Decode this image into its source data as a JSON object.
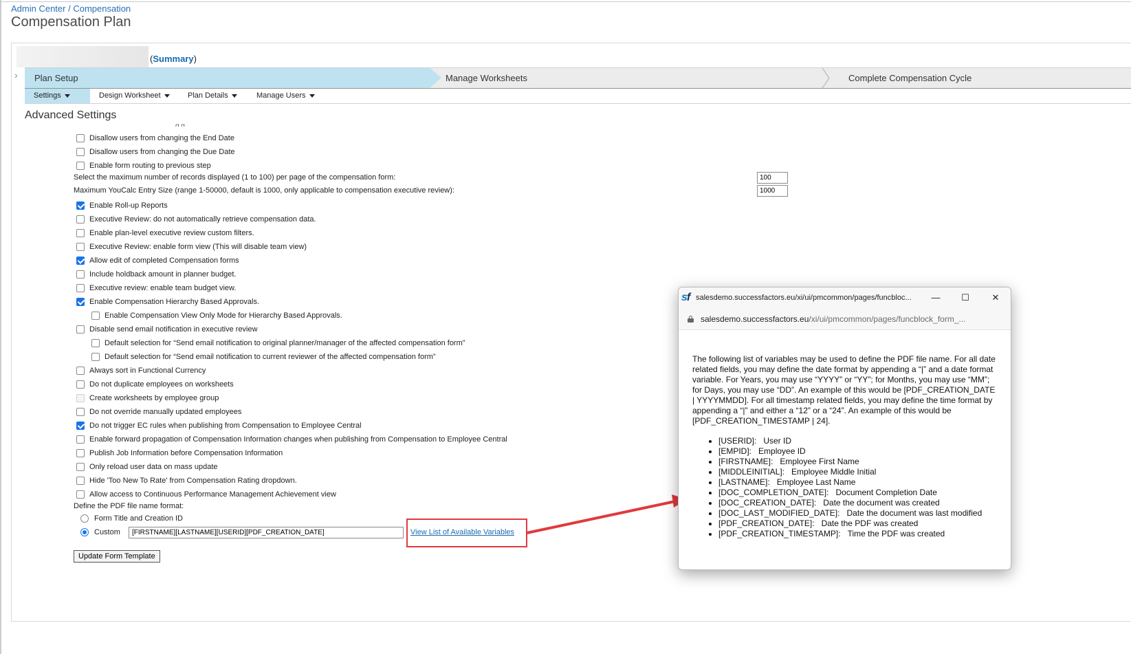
{
  "breadcrumb": {
    "admin_center": "Admin Center",
    "separator": " / ",
    "compensation": "Compensation"
  },
  "page_title": "Compensation Plan",
  "summary": {
    "open": "(",
    "link": "Summary",
    "close": ")"
  },
  "steps": [
    {
      "label": "Plan Setup",
      "active": true
    },
    {
      "label": "Manage Worksheets",
      "active": false
    },
    {
      "label": "Complete Compensation Cycle",
      "active": false
    }
  ],
  "subnav": [
    {
      "label": "Settings",
      "active": true
    },
    {
      "label": "Design Worksheet",
      "active": false
    },
    {
      "label": "Plan Details",
      "active": false
    },
    {
      "label": "Manage Users",
      "active": false
    }
  ],
  "section_title": "Advanced Settings",
  "settings": [
    {
      "label": "Disallow users from changing the End Date",
      "checked": false
    },
    {
      "label": "Disallow users from changing the Due Date",
      "checked": false
    },
    {
      "label": "Enable form routing to previous step",
      "checked": false
    },
    {
      "label": "Select the maximum number of records displayed (1 to 100) per page of the compensation form:",
      "value": "100"
    },
    {
      "label": "Maximum YouCalc Entry Size (range 1-50000, default is 1000, only applicable to compensation executive review):",
      "value": "1000"
    },
    {
      "label": "Enable Roll-up Reports",
      "checked": true
    },
    {
      "label": "Executive Review: do not automatically retrieve compensation data.",
      "checked": false
    },
    {
      "label": "Enable plan-level executive review custom filters.",
      "checked": false
    },
    {
      "label": "Executive Review: enable form view (This will disable team view)",
      "checked": false
    },
    {
      "label": "Allow edit of completed Compensation forms",
      "checked": true
    },
    {
      "label": "Include holdback amount in planner budget.",
      "checked": false
    },
    {
      "label": "Executive review: enable team budget view.",
      "checked": false
    },
    {
      "label": "Enable Compensation Hierarchy Based Approvals.",
      "checked": true
    },
    {
      "label": "Enable Compensation View Only Mode for Hierarchy Based Approvals.",
      "checked": false
    },
    {
      "label": "Disable send email notification in executive review",
      "checked": false
    },
    {
      "label": "Default selection for “Send email notification to original planner/manager of the affected compensation form”",
      "checked": false
    },
    {
      "label": "Default selection for “Send email notification to current reviewer of the affected compensation form”",
      "checked": false
    },
    {
      "label": "Always sort in Functional Currency",
      "checked": false
    },
    {
      "label": "Do not duplicate employees on worksheets",
      "checked": false
    },
    {
      "label": "Create worksheets by employee group",
      "checked": false,
      "disabled": true
    },
    {
      "label": "Do not override manually updated employees",
      "checked": false
    },
    {
      "label": "Do not trigger EC rules when publishing from Compensation to Employee Central",
      "checked": true
    },
    {
      "label": "Enable forward propagation of Compensation Information changes when publishing from Compensation to Employee Central",
      "checked": false
    },
    {
      "label": "Publish Job Information before Compensation Information",
      "checked": false
    },
    {
      "label": "Only reload user data on mass update",
      "checked": false
    },
    {
      "label": "Hide 'Too New To Rate' from Compensation Rating dropdown.",
      "checked": false
    },
    {
      "label": "Allow access to Continuous Performance Management Achievement view",
      "checked": false
    }
  ],
  "pdf_format": {
    "label": "Define the PDF file name format:",
    "options": [
      {
        "label": "Form Title and Creation ID",
        "selected": false
      },
      {
        "label": "Custom",
        "selected": true
      }
    ],
    "custom_value": "[FIRSTNAME][LASTNAME][USERID][PDF_CREATION_DATE]",
    "link": "View List of Available Variables"
  },
  "update_button": "Update Form Template",
  "popup": {
    "title": "salesdemo.successfactors.eu/xi/ui/pmcommon/pages/funcbloc...",
    "logo": "sf",
    "address_host": "salesdemo.successfactors.eu",
    "address_path": "/xi/ui/pmcommon/pages/funcblock_form_...",
    "intro": "The following list of variables may be used to define the PDF file name. For all date related fields, you may define the date format by appending a “|” and a date format variable. For Years, you may use “YYYY” or “YY”; for Months, you may use “MM”; for Days, you may use “DD”. An example of this would be [PDF_CREATION_DATE | YYYYMMDD]. For all timestamp related fields, you may define the time format by appending a “|” and either a “12” or a “24”. An example of this would be [PDF_CREATION_TIMESTAMP | 24].",
    "variables": [
      {
        "key": "[USERID]:",
        "desc": "User ID"
      },
      {
        "key": "[EMPID]:",
        "desc": "Employee ID"
      },
      {
        "key": "[FIRSTNAME]:",
        "desc": "Employee First Name"
      },
      {
        "key": "[MIDDLEINITIAL]:",
        "desc": "Employee Middle Initial"
      },
      {
        "key": "[LASTNAME]:",
        "desc": "Employee Last Name"
      },
      {
        "key": "[DOC_COMPLETION_DATE]:",
        "desc": "Document Completion Date"
      },
      {
        "key": "[DOC_CREATION_DATE]:",
        "desc": "Date the document was created"
      },
      {
        "key": "[DOC_LAST_MODIFIED_DATE]:",
        "desc": "Date the document was last modified"
      },
      {
        "key": "[PDF_CREATION_DATE]:",
        "desc": "Date the PDF was created"
      },
      {
        "key": "[PDF_CREATION_TIMESTAMP]:",
        "desc": "Time the PDF was created"
      }
    ]
  },
  "colors": {
    "accent": "#1a73e8",
    "link": "#1a6bb0",
    "step_active_bg": "#bfe2f0",
    "callout_red": "#e03a3e"
  }
}
